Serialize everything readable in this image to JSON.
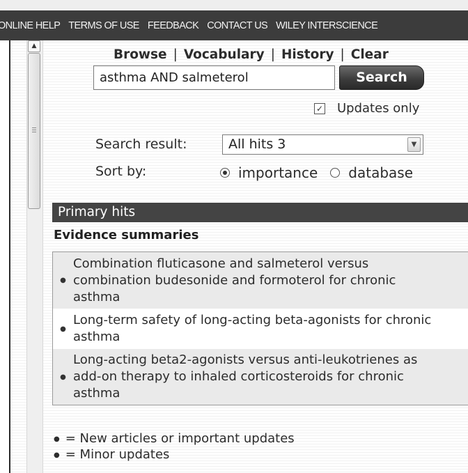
{
  "topnav": {
    "links": [
      "ONLINE HELP",
      "TERMS OF USE",
      "FEEDBACK",
      "CONTACT US",
      "WILEY INTERSCIENCE"
    ]
  },
  "toolbar": {
    "links": [
      "Browse",
      "Vocabulary",
      "History",
      "Clear"
    ],
    "separator": "|"
  },
  "search": {
    "value": "asthma AND salmeterol",
    "button_label": "Search"
  },
  "updates_only": {
    "label": "Updates only",
    "checked": true
  },
  "search_result": {
    "label": "Search result:",
    "selected": "All hits 3"
  },
  "sort": {
    "label": "Sort by:",
    "options": [
      {
        "label": "importance",
        "selected": true
      },
      {
        "label": "database",
        "selected": false
      }
    ]
  },
  "primary_hits": {
    "title": "Primary hits",
    "section_title": "Evidence summaries",
    "items": [
      {
        "bullet": "●",
        "lines": [
          "Combination fluticasone and salmeterol versus",
          "combination budesonide and formoterol for chronic",
          "asthma"
        ]
      },
      {
        "bullet": "●",
        "lines": [
          "Long-term safety of long-acting beta-agonists for chronic",
          "asthma"
        ]
      },
      {
        "bullet": "●",
        "lines": [
          "Long-acting beta2-agonists versus anti-leukotrienes as",
          "add-on therapy to inhaled corticosteroids for chronic",
          "asthma"
        ]
      }
    ]
  },
  "legend": {
    "new": "= New articles or important updates",
    "minor": "= Minor updates",
    "bullet": "●"
  },
  "colors": {
    "nav_bg": "#3c3c3c",
    "primary_bar": "#444444",
    "row_alt": "#eaeaea"
  },
  "icons": {
    "scroll_up": "triangle-up",
    "select_arrow": "chevron-down",
    "checkbox_check": "check-mark"
  }
}
